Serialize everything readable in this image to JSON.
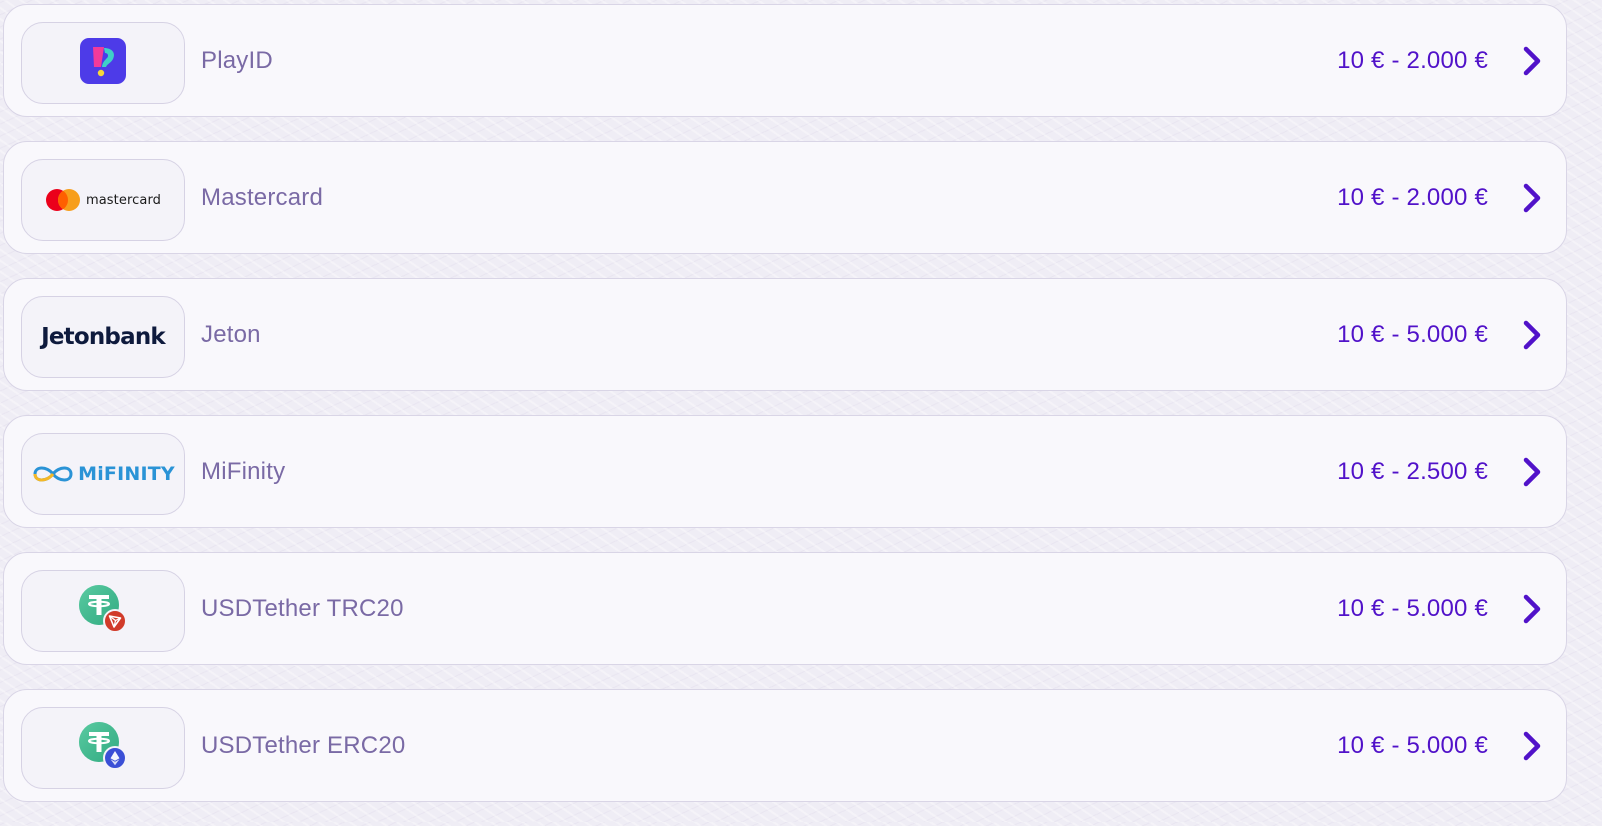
{
  "methods": [
    {
      "id": "playid",
      "logo_icon": "playid-logo-icon",
      "logo_text": "",
      "name": "PlayID",
      "range": "10 € - 2.000 €"
    },
    {
      "id": "mastercard",
      "logo_icon": "mastercard-logo-icon",
      "logo_text": "mastercard",
      "name": "Mastercard",
      "range": "10 € - 2.000 €"
    },
    {
      "id": "jeton",
      "logo_icon": "jetonbank-logo",
      "logo_text": "Jetonbank",
      "name": "Jeton",
      "range": "10 € - 5.000 €"
    },
    {
      "id": "mifinity",
      "logo_icon": "mifinity-logo-icon",
      "logo_text": "MiFINITY",
      "name": "MiFinity",
      "range": "10 € - 2.500 €"
    },
    {
      "id": "usdt-trc20",
      "logo_icon": "tether-tron-icon",
      "logo_text": "",
      "name": "USDTether TRC20",
      "range": "10 € - 5.000 €"
    },
    {
      "id": "usdt-erc20",
      "logo_icon": "tether-ethereum-icon",
      "logo_text": "",
      "name": "USDTether ERC20",
      "range": "10 € - 5.000 €"
    }
  ],
  "colors": {
    "accent": "#5112c9",
    "name_text": "#7a6aa5",
    "card_bg": "#f9f8fc",
    "border": "#d9d5e6",
    "tether_green": "#3dba8f",
    "tron_red": "#d13b2a",
    "eth_blue": "#3b4fd6",
    "mastercard_red": "#eb001b",
    "mastercard_orange": "#f79e1b",
    "mifinity_blue": "#2a93d6",
    "jeton_navy": "#0e1a3d"
  },
  "icons": {
    "chevron": "chevron-right-icon"
  }
}
